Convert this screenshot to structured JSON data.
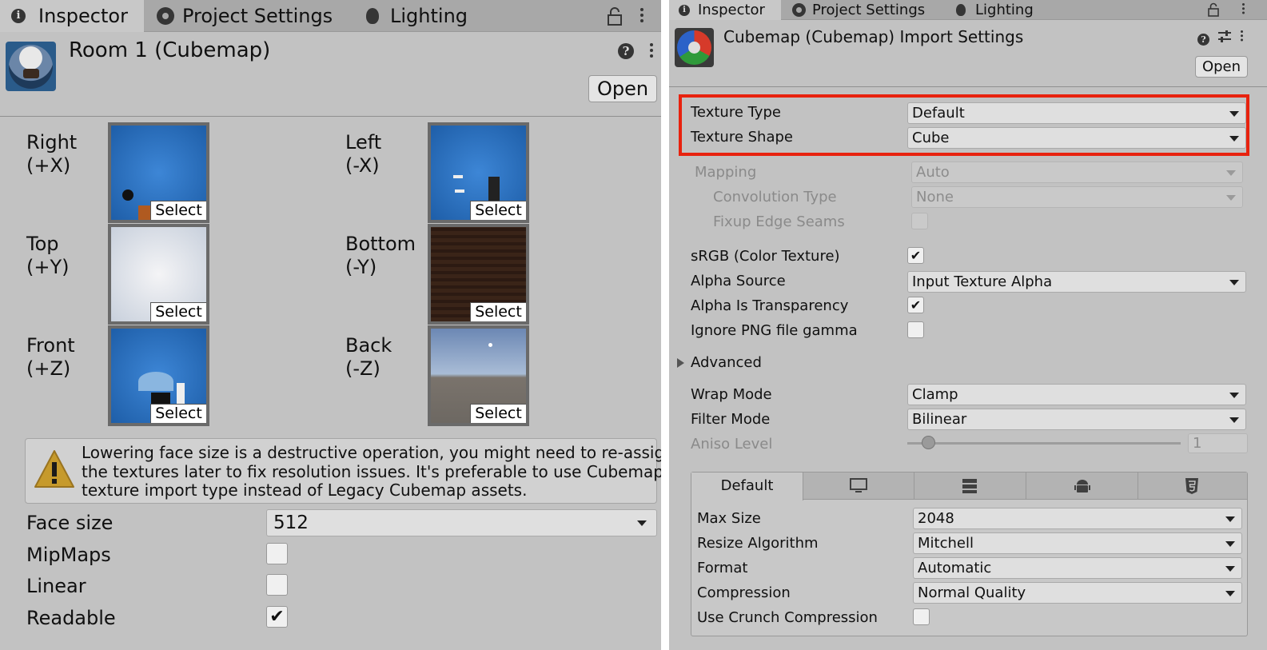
{
  "left": {
    "tabs": [
      {
        "label": "Inspector",
        "icon": "info-icon",
        "active": true
      },
      {
        "label": "Project Settings",
        "icon": "gear-icon",
        "active": false
      },
      {
        "label": "Lighting",
        "icon": "lightbulb-icon",
        "active": false
      }
    ],
    "title": "Room 1 (Cubemap)",
    "open_label": "Open",
    "faces": [
      {
        "name": "Right",
        "axis": "(+X)",
        "select": "Select"
      },
      {
        "name": "Left",
        "axis": "(-X)",
        "select": "Select"
      },
      {
        "name": "Top",
        "axis": "(+Y)",
        "select": "Select"
      },
      {
        "name": "Bottom",
        "axis": "(-Y)",
        "select": "Select"
      },
      {
        "name": "Front",
        "axis": "(+Z)",
        "select": "Select"
      },
      {
        "name": "Back",
        "axis": "(-Z)",
        "select": "Select"
      }
    ],
    "warning_lines": [
      "Lowering face size is a destructive operation, you might need to re-assign",
      "the textures later to fix resolution issues. It's preferable to use Cubemap",
      "texture import type instead of Legacy Cubemap assets."
    ],
    "face_size": {
      "label": "Face size",
      "value": "512"
    },
    "mipmaps": {
      "label": "MipMaps",
      "checked": false
    },
    "linear": {
      "label": "Linear",
      "checked": false
    },
    "readable": {
      "label": "Readable",
      "checked": true
    }
  },
  "right": {
    "tabs": [
      {
        "label": "Inspector",
        "icon": "info-icon",
        "active": true
      },
      {
        "label": "Project Settings",
        "icon": "gear-icon",
        "active": false
      },
      {
        "label": "Lighting",
        "icon": "lightbulb-icon",
        "active": false
      }
    ],
    "title": "Cubemap (Cubemap) Import Settings",
    "open_label": "Open",
    "texture_type": {
      "label": "Texture Type",
      "value": "Default"
    },
    "texture_shape": {
      "label": "Texture Shape",
      "value": "Cube"
    },
    "mapping": {
      "label": "Mapping",
      "value": "Auto"
    },
    "convolution": {
      "label": "Convolution Type",
      "value": "None"
    },
    "fixup": {
      "label": "Fixup Edge Seams"
    },
    "srgb": {
      "label": "sRGB (Color Texture)",
      "checked": true
    },
    "alpha_source": {
      "label": "Alpha Source",
      "value": "Input Texture Alpha"
    },
    "alpha_transparency": {
      "label": "Alpha Is Transparency",
      "checked": true
    },
    "ignore_png": {
      "label": "Ignore PNG file gamma",
      "checked": false
    },
    "advanced": "Advanced",
    "wrap_mode": {
      "label": "Wrap Mode",
      "value": "Clamp"
    },
    "filter_mode": {
      "label": "Filter Mode",
      "value": "Bilinear"
    },
    "aniso": {
      "label": "Aniso Level",
      "value": "1",
      "slider_fraction": 0.05
    },
    "platform_tabs": [
      "Default",
      "monitor-icon",
      "server-icon",
      "android-icon",
      "html5-icon"
    ],
    "max_size": {
      "label": "Max Size",
      "value": "2048"
    },
    "resize": {
      "label": "Resize Algorithm",
      "value": "Mitchell"
    },
    "format": {
      "label": "Format",
      "value": "Automatic"
    },
    "compression": {
      "label": "Compression",
      "value": "Normal Quality"
    },
    "crunch": {
      "label": "Use Crunch Compression",
      "checked": false
    },
    "highlight_color": "#e8220e"
  }
}
